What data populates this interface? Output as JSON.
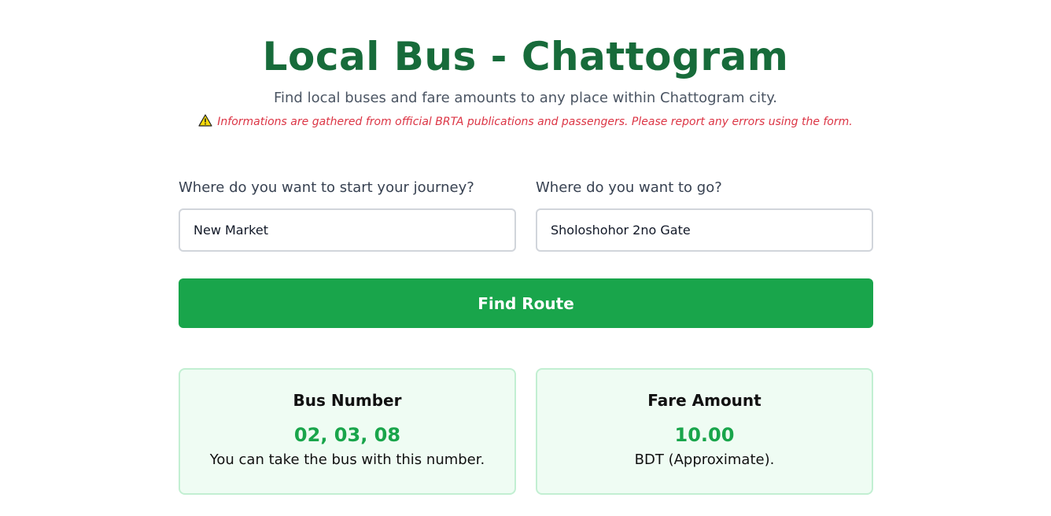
{
  "header": {
    "title": "Local Bus - Chattogram",
    "subtitle": "Find local buses and fare amounts to any place within Chattogram city.",
    "notice": "Informations are gathered from official BRTA publications and passengers. Please report any errors using the form.",
    "notice_icon": "warning-icon"
  },
  "form": {
    "start_label": "Where do you want to start your journey?",
    "start_value": "New Market",
    "destination_label": "Where do you want to go?",
    "destination_value": "Sholoshohor 2no Gate",
    "submit_label": "Find Route"
  },
  "results": {
    "bus": {
      "title": "Bus Number",
      "value": "02, 03, 08",
      "note": "You can take the bus with this number."
    },
    "fare": {
      "title": "Fare Amount",
      "value": "10.00",
      "note": "BDT (Approximate)."
    }
  },
  "colors": {
    "title": "#176b3a",
    "accent": "#19a54b",
    "notice": "#dc3545",
    "card_bg": "#effcf3",
    "card_border": "#c2efd2"
  }
}
